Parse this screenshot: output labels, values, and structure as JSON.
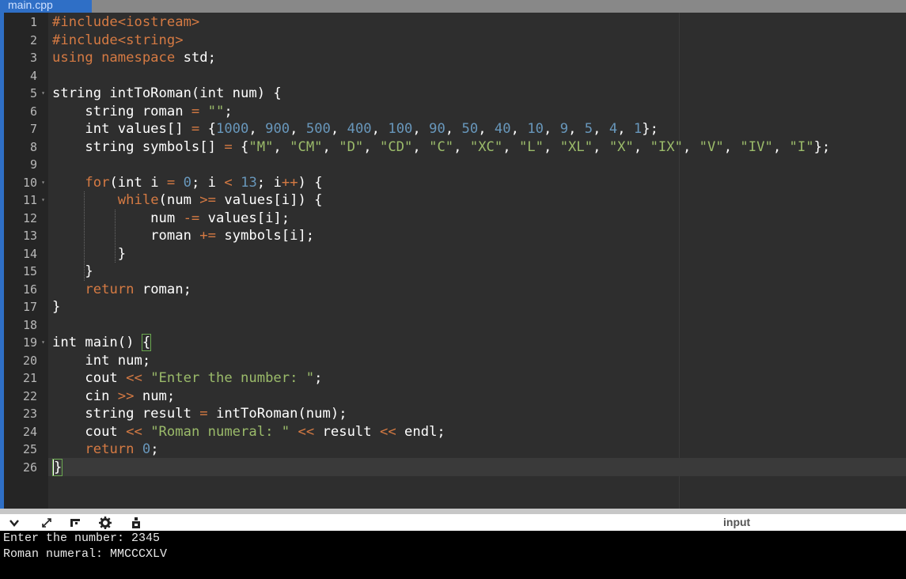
{
  "tab": {
    "title": "main.cpp"
  },
  "editor": {
    "lines": [
      [
        {
          "t": "#include<iostream>",
          "c": "inc"
        }
      ],
      [
        {
          "t": "#include<string>",
          "c": "inc"
        }
      ],
      [
        {
          "t": "using namespace",
          "c": "kw"
        },
        {
          "t": " std;"
        }
      ],
      [],
      [
        {
          "t": "string intToRoman(int num) {"
        }
      ],
      [
        {
          "t": "    string roman "
        },
        {
          "t": "=",
          "c": "op"
        },
        {
          "t": " "
        },
        {
          "t": "\"\"",
          "c": "str"
        },
        {
          "t": ";"
        }
      ],
      [
        {
          "t": "    int values[] "
        },
        {
          "t": "=",
          "c": "op"
        },
        {
          "t": " {"
        },
        {
          "t": "1000",
          "c": "num-lit"
        },
        {
          "t": ", "
        },
        {
          "t": "900",
          "c": "num-lit"
        },
        {
          "t": ", "
        },
        {
          "t": "500",
          "c": "num-lit"
        },
        {
          "t": ", "
        },
        {
          "t": "400",
          "c": "num-lit"
        },
        {
          "t": ", "
        },
        {
          "t": "100",
          "c": "num-lit"
        },
        {
          "t": ", "
        },
        {
          "t": "90",
          "c": "num-lit"
        },
        {
          "t": ", "
        },
        {
          "t": "50",
          "c": "num-lit"
        },
        {
          "t": ", "
        },
        {
          "t": "40",
          "c": "num-lit"
        },
        {
          "t": ", "
        },
        {
          "t": "10",
          "c": "num-lit"
        },
        {
          "t": ", "
        },
        {
          "t": "9",
          "c": "num-lit"
        },
        {
          "t": ", "
        },
        {
          "t": "5",
          "c": "num-lit"
        },
        {
          "t": ", "
        },
        {
          "t": "4",
          "c": "num-lit"
        },
        {
          "t": ", "
        },
        {
          "t": "1",
          "c": "num-lit"
        },
        {
          "t": "};"
        }
      ],
      [
        {
          "t": "    string symbols[] "
        },
        {
          "t": "=",
          "c": "op"
        },
        {
          "t": " {"
        },
        {
          "t": "\"M\"",
          "c": "str"
        },
        {
          "t": ", "
        },
        {
          "t": "\"CM\"",
          "c": "str"
        },
        {
          "t": ", "
        },
        {
          "t": "\"D\"",
          "c": "str"
        },
        {
          "t": ", "
        },
        {
          "t": "\"CD\"",
          "c": "str"
        },
        {
          "t": ", "
        },
        {
          "t": "\"C\"",
          "c": "str"
        },
        {
          "t": ", "
        },
        {
          "t": "\"XC\"",
          "c": "str"
        },
        {
          "t": ", "
        },
        {
          "t": "\"L\"",
          "c": "str"
        },
        {
          "t": ", "
        },
        {
          "t": "\"XL\"",
          "c": "str"
        },
        {
          "t": ", "
        },
        {
          "t": "\"X\"",
          "c": "str"
        },
        {
          "t": ", "
        },
        {
          "t": "\"IX\"",
          "c": "str"
        },
        {
          "t": ", "
        },
        {
          "t": "\"V\"",
          "c": "str"
        },
        {
          "t": ", "
        },
        {
          "t": "\"IV\"",
          "c": "str"
        },
        {
          "t": ", "
        },
        {
          "t": "\"I\"",
          "c": "str"
        },
        {
          "t": "};"
        }
      ],
      [],
      [
        {
          "t": "    "
        },
        {
          "t": "for",
          "c": "kw"
        },
        {
          "t": "(int i "
        },
        {
          "t": "=",
          "c": "op"
        },
        {
          "t": " "
        },
        {
          "t": "0",
          "c": "num-lit"
        },
        {
          "t": "; i "
        },
        {
          "t": "<",
          "c": "op"
        },
        {
          "t": " "
        },
        {
          "t": "13",
          "c": "num-lit"
        },
        {
          "t": "; i"
        },
        {
          "t": "++",
          "c": "op"
        },
        {
          "t": ") {"
        }
      ],
      [
        {
          "t": "        "
        },
        {
          "t": "while",
          "c": "kw"
        },
        {
          "t": "(num "
        },
        {
          "t": ">=",
          "c": "op"
        },
        {
          "t": " values[i]) {"
        }
      ],
      [
        {
          "t": "            num "
        },
        {
          "t": "-=",
          "c": "op"
        },
        {
          "t": " values[i];"
        }
      ],
      [
        {
          "t": "            roman "
        },
        {
          "t": "+=",
          "c": "op"
        },
        {
          "t": " symbols[i];"
        }
      ],
      [
        {
          "t": "        }"
        }
      ],
      [
        {
          "t": "    }"
        }
      ],
      [
        {
          "t": "    "
        },
        {
          "t": "return",
          "c": "kw"
        },
        {
          "t": " roman;"
        }
      ],
      [
        {
          "t": "}"
        }
      ],
      [],
      [
        {
          "t": "int main() "
        },
        {
          "t": "{",
          "c": "br"
        }
      ],
      [
        {
          "t": "    int num;"
        }
      ],
      [
        {
          "t": "    cout "
        },
        {
          "t": "<<",
          "c": "op"
        },
        {
          "t": " "
        },
        {
          "t": "\"Enter the number: \"",
          "c": "str"
        },
        {
          "t": ";"
        }
      ],
      [
        {
          "t": "    cin "
        },
        {
          "t": ">>",
          "c": "op"
        },
        {
          "t": " num;"
        }
      ],
      [
        {
          "t": "    string result "
        },
        {
          "t": "=",
          "c": "op"
        },
        {
          "t": " intToRoman(num);"
        }
      ],
      [
        {
          "t": "    cout "
        },
        {
          "t": "<<",
          "c": "op"
        },
        {
          "t": " "
        },
        {
          "t": "\"Roman numeral: \"",
          "c": "str"
        },
        {
          "t": " "
        },
        {
          "t": "<<",
          "c": "op"
        },
        {
          "t": " result "
        },
        {
          "t": "<<",
          "c": "op"
        },
        {
          "t": " endl;"
        }
      ],
      [
        {
          "t": "    "
        },
        {
          "t": "return",
          "c": "kw"
        },
        {
          "t": " "
        },
        {
          "t": "0",
          "c": "num-lit"
        },
        {
          "t": ";"
        }
      ],
      [
        {
          "t": "}",
          "c": "br cursor"
        }
      ]
    ],
    "line_numbers": [
      "1",
      "2",
      "3",
      "4",
      "5",
      "6",
      "7",
      "8",
      "9",
      "10",
      "11",
      "12",
      "13",
      "14",
      "15",
      "16",
      "17",
      "18",
      "19",
      "20",
      "21",
      "22",
      "23",
      "24",
      "25",
      "26"
    ],
    "fold_lines": [
      5,
      10,
      11,
      19
    ]
  },
  "toolbar": {
    "icons": [
      "chevron-down-icon",
      "expand-icon",
      "layout-icon",
      "gear-icon",
      "run-icon"
    ],
    "input_label": "input"
  },
  "console": {
    "output": [
      "Enter the number: 2345",
      "Roman numeral: MMCCCXLV"
    ]
  },
  "colors": {
    "editor_bg": "#2e2e2e",
    "gutter_bg": "#252525",
    "keyword": "#d57a43",
    "number": "#6897bb",
    "string": "#9bbb6a",
    "tab_bg": "#2f6fc6"
  }
}
